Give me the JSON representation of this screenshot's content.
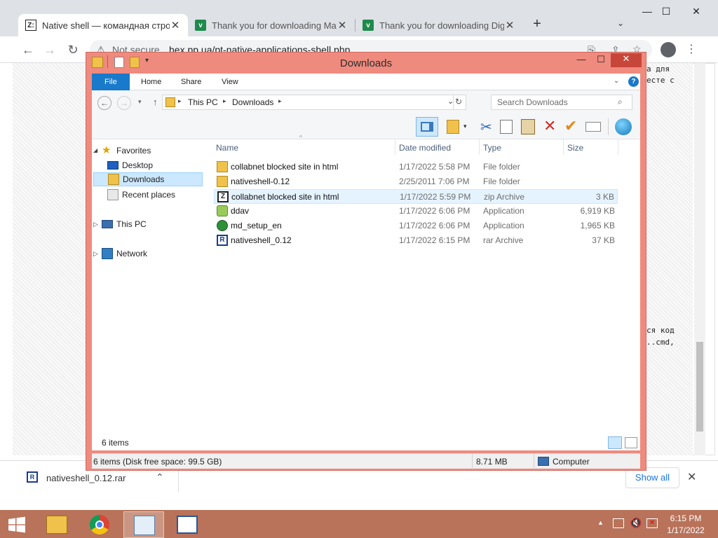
{
  "browser": {
    "tabs": [
      {
        "title": "Native shell — командная строка",
        "favicon": "Z:"
      },
      {
        "title": "Thank you for downloading Mahar",
        "favicon": "v"
      },
      {
        "title": "Thank you for downloading Digita",
        "favicon": "v"
      }
    ],
    "address": {
      "security": "Not secure",
      "url": "hex.pp.ua/pt-native-applications-shell.php"
    },
    "page_text_fragments": [
      "а для",
      "есте с",
      "ся код",
      "..cmd,"
    ],
    "download_shelf": {
      "file": "nativeshell_0.12.rar",
      "show_all": "Show all"
    }
  },
  "explorer": {
    "title": "Downloads",
    "ribbon_tabs": [
      "File",
      "Home",
      "Share",
      "View"
    ],
    "breadcrumb": [
      "This PC",
      "Downloads"
    ],
    "search_placeholder": "Search Downloads",
    "nav": {
      "favorites": "Favorites",
      "desktop": "Desktop",
      "downloads": "Downloads",
      "recent": "Recent places",
      "thispc": "This PC",
      "network": "Network"
    },
    "columns": {
      "name": "Name",
      "date": "Date modified",
      "type": "Type",
      "size": "Size"
    },
    "files": [
      {
        "name": "collabnet blocked site in html",
        "date": "1/17/2022 5:58 PM",
        "type": "File folder",
        "size": "",
        "icon": "folder-icon"
      },
      {
        "name": "nativeshell-0.12",
        "date": "2/25/2011 7:06 PM",
        "type": "File folder",
        "size": "",
        "icon": "folder-icon"
      },
      {
        "name": "collabnet blocked site in html",
        "date": "1/17/2022 5:59 PM",
        "type": "zip Archive",
        "size": "3 KB",
        "icon": "zip-icon"
      },
      {
        "name": "ddav",
        "date": "1/17/2022 6:06 PM",
        "type": "Application",
        "size": "6,919 KB",
        "icon": "app-icon"
      },
      {
        "name": "md_setup_en",
        "date": "1/17/2022 6:06 PM",
        "type": "Application",
        "size": "1,965 KB",
        "icon": "setup-icon"
      },
      {
        "name": "nativeshell_0.12",
        "date": "1/17/2022 6:15 PM",
        "type": "rar Archive",
        "size": "37 KB",
        "icon": "rar-icon"
      }
    ],
    "items_count": "6 items",
    "status": {
      "left": "6 items (Disk free space: 99.5 GB)",
      "size": "8.71 MB",
      "location": "Computer"
    }
  },
  "taskbar": {
    "time": "6:15 PM",
    "date": "1/17/2022"
  }
}
